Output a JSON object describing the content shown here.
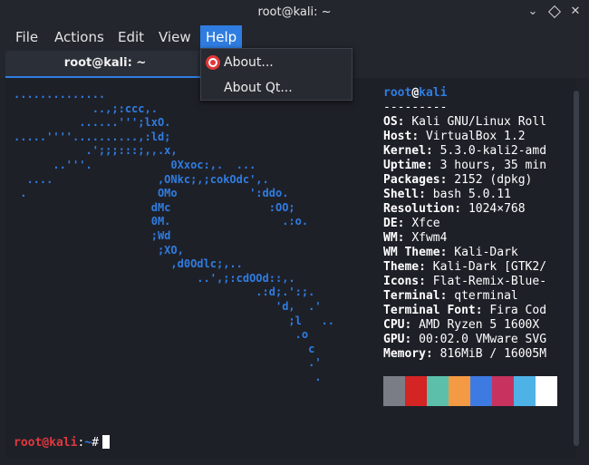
{
  "window": {
    "title": "root@kali: ~"
  },
  "menubar": {
    "file": "File",
    "actions": "Actions",
    "edit": "Edit",
    "view": "View",
    "help": "Help"
  },
  "tab": {
    "label": "root@kali: ~"
  },
  "help_menu": {
    "about": "About...",
    "about_qt": "About Qt..."
  },
  "logo": [
    "..............",
    "            ..,;:ccc,.",
    "          ......''';lxO.",
    ".....''''..........,:ld;",
    "           .';;;:::;,,.x,",
    "      ..'''.            0Xxoc:,.  ...",
    "  ....                ,ONkc;,;cokOdc',.",
    " .                    OMo           ':ddo.",
    "                     dMc               :OO;",
    "                     0M.                 .:o.",
    "                     ;Wd",
    "                      ;XO,",
    "                        ,d0Odlc;,..",
    "                            ..',;:cdOOd::,.",
    "                                     .:d;.':;.",
    "                                        'd,  .'",
    "                                          ;l   ..",
    "                                           .o",
    "                                             c",
    "                                             .'",
    "                                              ."
  ],
  "neofetch": {
    "user": "root",
    "at": "@",
    "host": "kali",
    "separator": "---------",
    "rows": [
      {
        "key": "OS",
        "value": "Kali GNU/Linux Roll"
      },
      {
        "key": "Host",
        "value": "VirtualBox 1.2"
      },
      {
        "key": "Kernel",
        "value": "5.3.0-kali2-amd"
      },
      {
        "key": "Uptime",
        "value": "3 hours, 35 min"
      },
      {
        "key": "Packages",
        "value": "2152 (dpkg)"
      },
      {
        "key": "Shell",
        "value": "bash 5.0.11"
      },
      {
        "key": "Resolution",
        "value": "1024×768"
      },
      {
        "key": "DE",
        "value": "Xfce"
      },
      {
        "key": "WM",
        "value": "Xfwm4"
      },
      {
        "key": "WM Theme",
        "value": "Kali-Dark"
      },
      {
        "key": "Theme",
        "value": "Kali-Dark [GTK2/"
      },
      {
        "key": "Icons",
        "value": "Flat-Remix-Blue-"
      },
      {
        "key": "Terminal",
        "value": "qterminal"
      },
      {
        "key": "Terminal Font",
        "value": "Fira Cod"
      },
      {
        "key": "CPU",
        "value": "AMD Ryzen 5 1600X"
      },
      {
        "key": "GPU",
        "value": "00:02.0 VMware SVG"
      },
      {
        "key": "Memory",
        "value": "816MiB / 16005M"
      }
    ],
    "palette": [
      "#7a7d86",
      "#d42424",
      "#5bbfa9",
      "#f59a44",
      "#3d7be3",
      "#c7335e",
      "#4fb2e6",
      "#ffffff"
    ]
  },
  "prompt": {
    "user": "root@kali",
    "sep": ":",
    "path": "~",
    "symbol": "#"
  }
}
